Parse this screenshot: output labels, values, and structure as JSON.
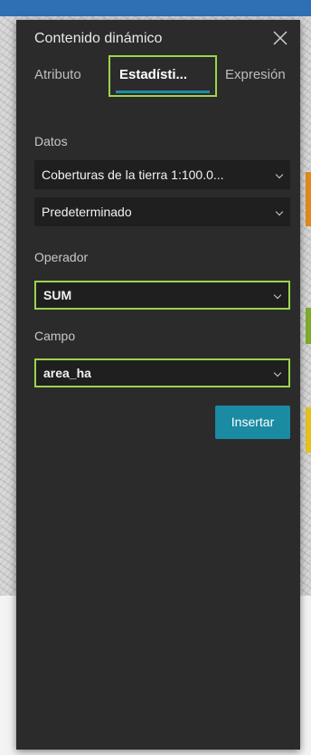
{
  "panel": {
    "title": "Contenido dinámico",
    "tabs": [
      {
        "label": "Atributo"
      },
      {
        "label": "Estadísti..."
      },
      {
        "label": "Expresión"
      }
    ],
    "datos": {
      "label": "Datos",
      "layer_value": "Coberturas de la tierra 1:100.0...",
      "view_value": "Predeterminado"
    },
    "operador": {
      "label": "Operador",
      "value": "SUM"
    },
    "campo": {
      "label": "Campo",
      "value": "area_ha"
    },
    "insert_label": "Insertar"
  },
  "icons": {
    "close": "close-icon",
    "dropdown": "chevron-down-icon"
  },
  "colors": {
    "panel_bg": "#2b2b2b",
    "accent": "#1b8aa3",
    "highlight": "#9ed34f"
  }
}
